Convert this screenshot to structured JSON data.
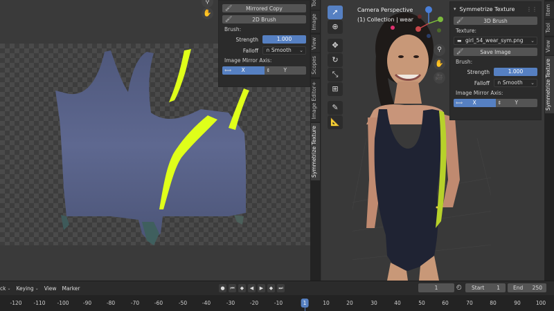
{
  "left_editor": {
    "npanel": {
      "mirrored_copy_label": "Mirrored Copy",
      "brush_button_label": "2D Brush",
      "brush_section": "Brush:",
      "strength_label": "Strength",
      "strength_value": "1.000",
      "falloff_label": "Falloff",
      "falloff_value": "Smooth",
      "mirror_axis_label": "Image Mirror Axis:",
      "axis_x": "X",
      "axis_y": "Y"
    },
    "tabs": [
      "Tool",
      "Image",
      "View",
      "Scopes",
      "Image Editor+",
      "Symmetrize Texture"
    ]
  },
  "viewport": {
    "camera_label": "Camera Perspective",
    "collection_label": "(1) Collection | wear",
    "npanel": {
      "title": "Symmetrize Texture",
      "brush_button_label": "3D Brush",
      "texture_section": "Texture:",
      "texture_file": "girl_54_wear_sym.png",
      "save_image_label": "Save Image",
      "brush_section": "Brush:",
      "strength_label": "Strength",
      "strength_value": "1.000",
      "falloff_label": "Falloff",
      "falloff_value": "Smooth",
      "mirror_axis_label": "Image Mirror Axis:",
      "axis_x": "X",
      "axis_y": "Y"
    },
    "tabs": [
      "Item",
      "Tool",
      "View",
      "Symmetrize Texture"
    ]
  },
  "timeline": {
    "menus": [
      "ck",
      "Keying",
      "View",
      "Marker"
    ],
    "current_frame": "1",
    "start_label": "Start",
    "start_value": "1",
    "end_label": "End",
    "end_value": "250",
    "ticks": [
      "-120",
      "-110",
      "-100",
      "-90",
      "-80",
      "-70",
      "-60",
      "-50",
      "-40",
      "-30",
      "-20",
      "-10",
      "1",
      "10",
      "20",
      "30",
      "40",
      "50",
      "60",
      "70",
      "80",
      "90",
      "100"
    ]
  },
  "colors": {
    "accent": "#5680c2",
    "highlight_paint": "#dfff1a",
    "garment": "#5a6488"
  }
}
